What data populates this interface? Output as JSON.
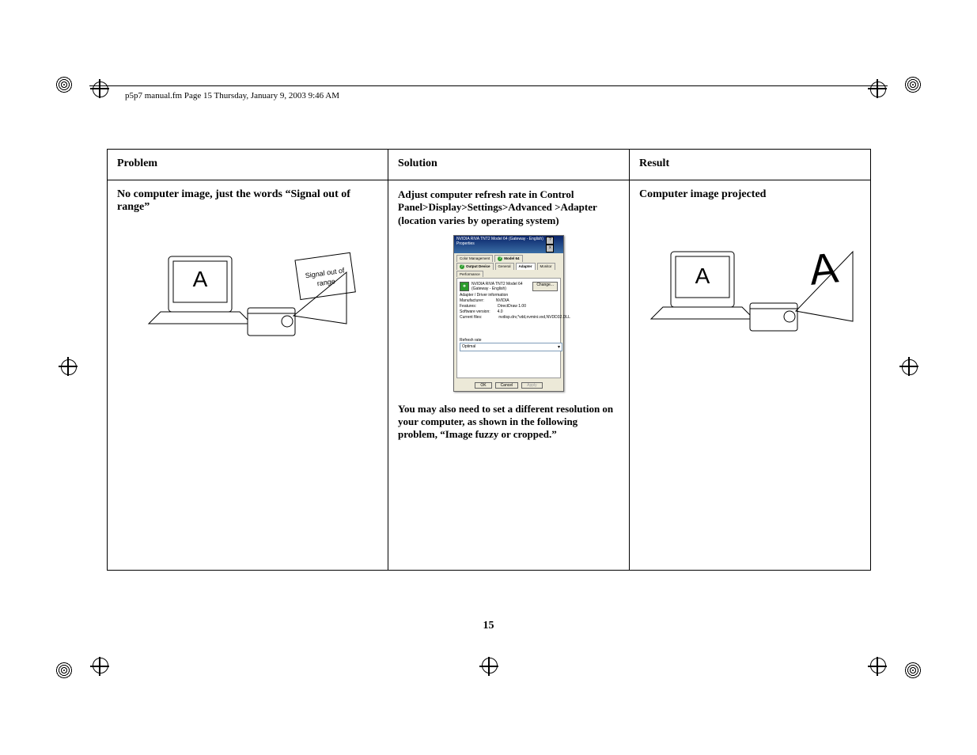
{
  "header": {
    "running_head": "p5p7 manual.fm  Page 15  Thursday, January 9, 2003  9:46 AM"
  },
  "table": {
    "headers": {
      "problem": "Problem",
      "solution": "Solution",
      "result": "Result"
    },
    "row": {
      "problem_text": "No computer image, just the words “Signal out of range”",
      "problem_screen_label": "A",
      "problem_projection_label": "Signal out of range",
      "solution_text": "Adjust computer refresh rate in Control Panel>Display>Settings>Advanced >Adapter (location varies by operating system)",
      "solution_text2": "You may also need to set a different resolution on your computer, as shown in the following problem, “Image fuzzy or cropped.”",
      "result_text": "Computer image projected",
      "result_screen_label": "A",
      "result_projection_label": "A"
    }
  },
  "dialog": {
    "title": "NVIDIA RIVA TNT2 Model 64 (Gateway - English) Properties",
    "tabs": {
      "color": "Color Management",
      "model": "Model 64",
      "output": "Output Device",
      "general": "General",
      "adapter": "Adapter",
      "monitor": "Monitor",
      "perf": "Performance"
    },
    "adapter_name": "NVIDIA RIVA TNT2 Model 64 (Gateway - English)",
    "change_btn": "Change...",
    "section": "Adapter / Driver information",
    "info": {
      "manufacturer_label": "Manufacturer:",
      "manufacturer_val": "NVIDIA",
      "features_label": "Features:",
      "features_val": "DirectDraw 1.00",
      "software_label": "Software version:",
      "software_val": "4.0",
      "files_label": "Current files:",
      "files_val": "nvdisp.drv,*vdd,nvmini.vxd,NVDD32.DLL"
    },
    "refresh_label": "Refresh rate",
    "refresh_val": "Optimal",
    "buttons": {
      "ok": "OK",
      "cancel": "Cancel",
      "apply": "Apply"
    }
  },
  "page_number": "15"
}
